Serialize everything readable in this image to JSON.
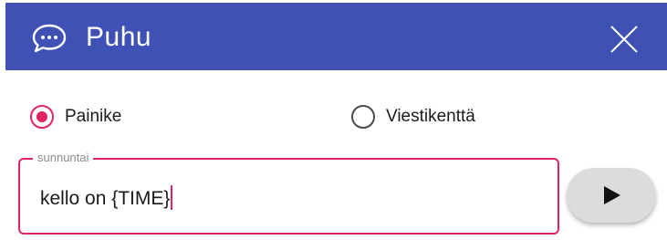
{
  "dialog": {
    "title": "Puhu",
    "header_icon": "speech-bubble-dots-icon",
    "close_icon": "close-icon",
    "header_color": "#3f51b5"
  },
  "mode_options": [
    {
      "label": "Painike",
      "checked": true
    },
    {
      "label": "Viestikenttä",
      "checked": false
    }
  ],
  "message_field": {
    "label": "sunnuntai",
    "value": "kello on {TIME}",
    "accent_color": "#e0245e"
  },
  "send_button": {
    "icon": "play-icon"
  }
}
